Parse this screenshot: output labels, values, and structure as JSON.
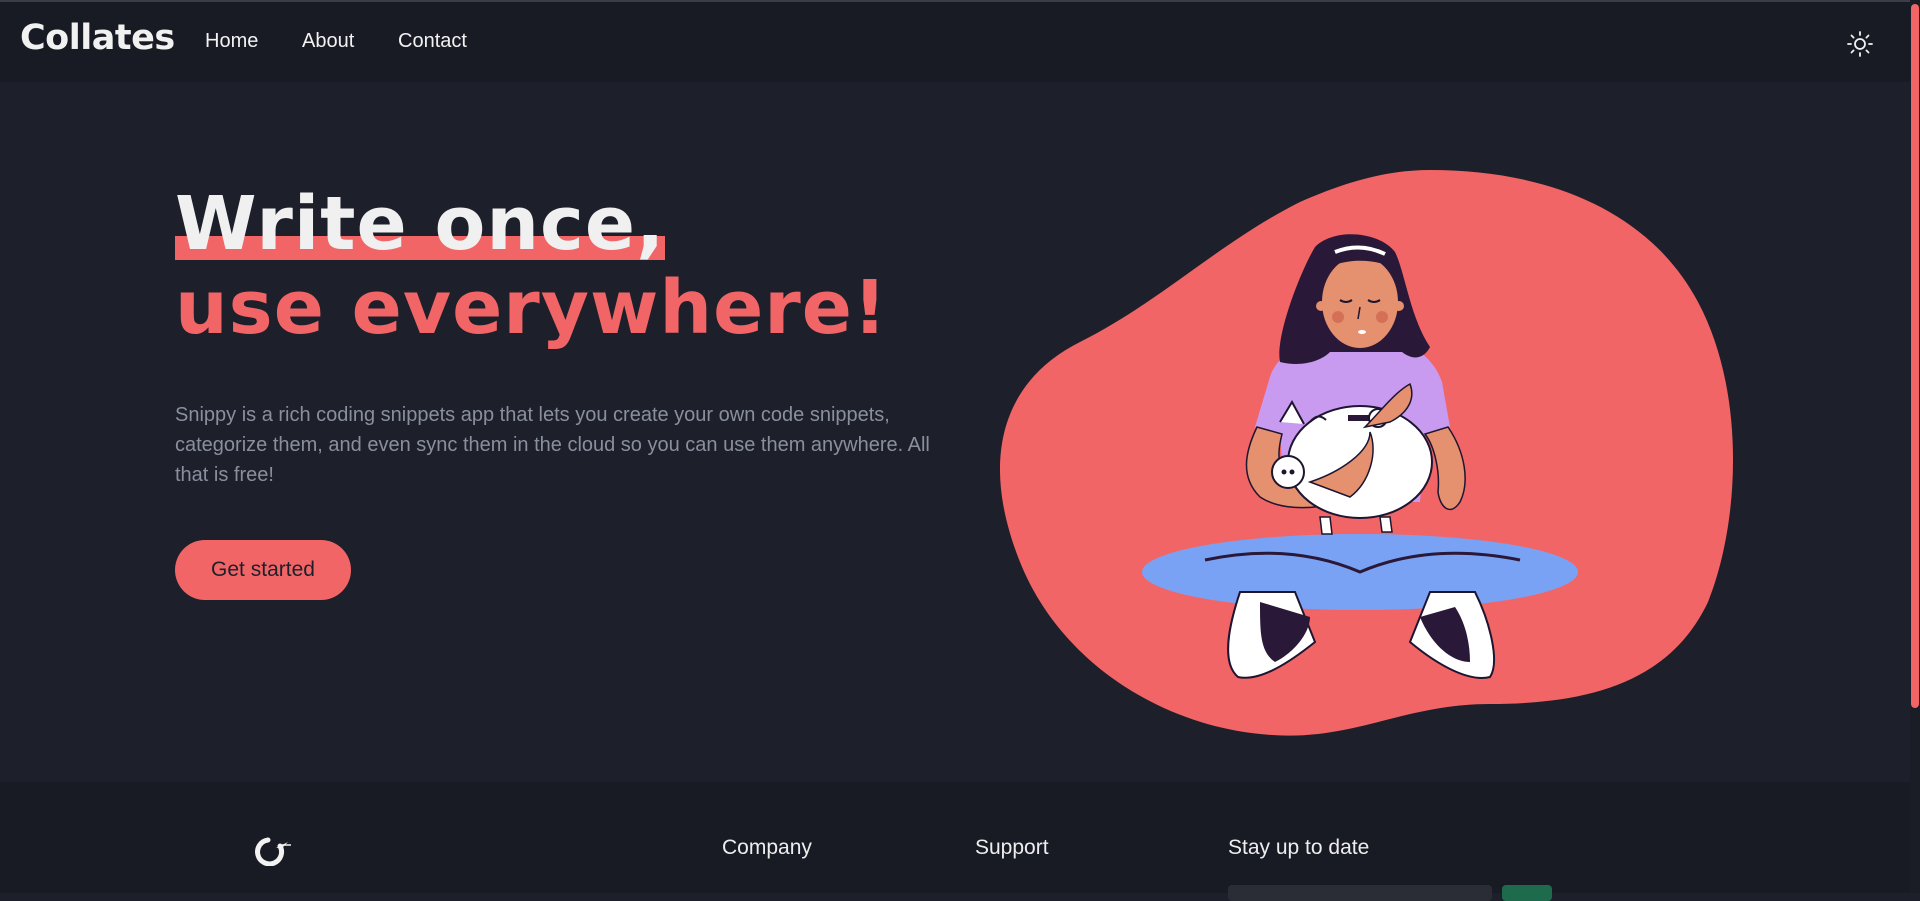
{
  "navbar": {
    "brand": "Collates",
    "links": [
      "Home",
      "About",
      "Contact"
    ],
    "theme_icon": "sun-icon"
  },
  "hero": {
    "headline_line1": "Write once,",
    "headline_line2": "use everywhere!",
    "description": "Snippy is a rich coding snippets app that lets you create your own code snippets, categorize them, and even sync them in the cloud so you can use them anywhere. All that is free!",
    "cta_label": "Get started",
    "illustration_icon": "woman-with-piggy-bank-illustration"
  },
  "footer": {
    "logo_icon": "logo-icon",
    "headings": [
      "Company",
      "Support",
      "Stay up to date"
    ]
  },
  "colors": {
    "accent": "#f26566",
    "background": "#1d202b",
    "navbar": "#181b24",
    "text_muted": "#8a8f9e",
    "subscribe_button": "#1e6a4c"
  }
}
